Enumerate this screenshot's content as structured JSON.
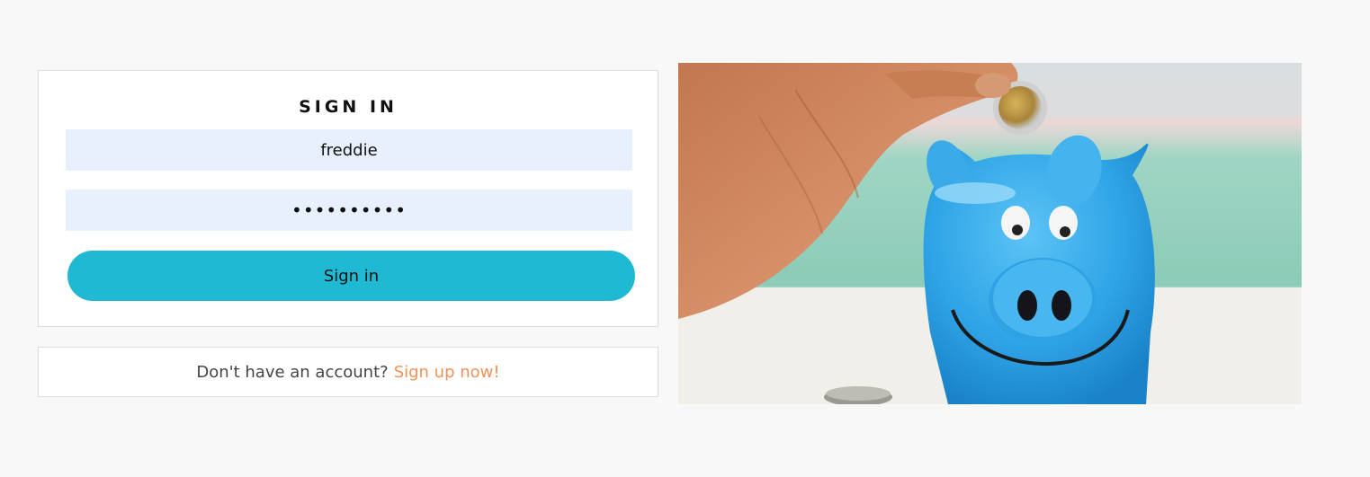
{
  "signin": {
    "title": "SIGN IN",
    "username_value": "freddie",
    "password_value": "password12",
    "button_label": "Sign in"
  },
  "signup": {
    "prompt": "Don't have an account?",
    "link_label": "Sign up now!"
  },
  "colors": {
    "page_background": "#f8f8f8",
    "input_background": "#e8f0fe",
    "button_background": "#1fb9d4",
    "link": "#f0915a"
  }
}
